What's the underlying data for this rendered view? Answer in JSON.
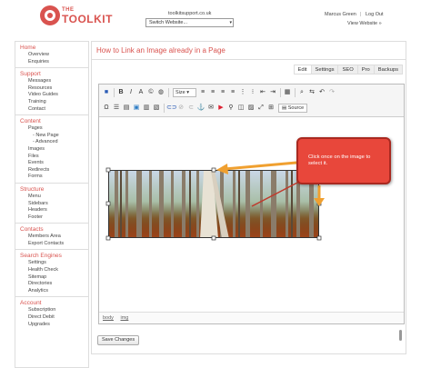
{
  "header": {
    "logo_the": "THE",
    "logo_name": "TOOLKIT",
    "site_url": "toolkitsupport.co.uk",
    "site_select": "Switch Website...",
    "user_name": "Marcus Green",
    "separator": "|",
    "logout": "Log Out",
    "view_site": "View Website »"
  },
  "sidebar": {
    "sections": [
      {
        "head": "Home",
        "items": [
          "Overview",
          "Enquiries"
        ]
      },
      {
        "head": "Support",
        "items": [
          "Messages",
          "Resources",
          "Video Guides",
          "Training",
          "Contact"
        ]
      },
      {
        "head": "Content",
        "items": [
          "Pages",
          "- New Page",
          "- Advanced",
          "Images",
          "Files",
          "Events",
          "Redirects",
          "Forms"
        ]
      },
      {
        "head": "Structure",
        "items": [
          "Menu",
          "Sidebars",
          "Headers",
          "Footer"
        ]
      },
      {
        "head": "Contacts",
        "items": [
          "Members Area",
          "Export Contacts"
        ]
      },
      {
        "head": "Search Engines",
        "items": [
          "Settings",
          "Health Check",
          "Sitemap",
          "Directories",
          "Analytics"
        ]
      },
      {
        "head": "Account",
        "items": [
          "Subscription",
          "Direct Debit",
          "Upgrades"
        ]
      }
    ]
  },
  "main": {
    "title": "How to Link an Image already in a Page",
    "tabs": [
      "Edit",
      "Settings",
      "SEO",
      "Pro",
      "Backups"
    ],
    "active_tab": "Edit"
  },
  "editor": {
    "size_label": "Size",
    "source_label": "Source",
    "status_items": [
      "body",
      "img"
    ]
  },
  "callout": {
    "text": "Click once on the image to select it."
  },
  "actions": {
    "save_label": "Save Changes"
  },
  "colors": {
    "accent": "#d9534f",
    "callout": "#e8473b",
    "arrow": "#f0a030"
  }
}
